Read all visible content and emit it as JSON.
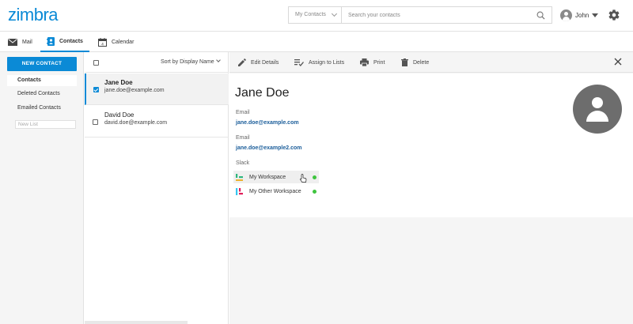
{
  "app": {
    "logo": "zimbra"
  },
  "search": {
    "scope": "My Contacts",
    "placeholder": "Search your contacts"
  },
  "user": {
    "name": "John"
  },
  "nav": {
    "tabs": [
      {
        "label": "Mail"
      },
      {
        "label": "Contacts"
      },
      {
        "label": "Calendar"
      }
    ]
  },
  "sidebar": {
    "new_contact_label": "NEW CONTACT",
    "items": [
      {
        "label": "Contacts"
      },
      {
        "label": "Deleted Contacts"
      },
      {
        "label": "Emailed Contacts"
      }
    ],
    "new_list_placeholder": "New List"
  },
  "list": {
    "sort_label": "Sort by Display Name",
    "contacts": [
      {
        "name": "Jane Doe",
        "email": "jane.doe@example.com",
        "checked": true
      },
      {
        "name": "David Doe",
        "email": "david.doe@example.com",
        "checked": false
      }
    ]
  },
  "toolbar": {
    "edit": "Edit Details",
    "assign": "Assign to Lists",
    "print": "Print",
    "delete": "Delete"
  },
  "detail": {
    "name": "Jane Doe",
    "fields": [
      {
        "label": "Email",
        "value": "jane.doe@example.com"
      },
      {
        "label": "Email",
        "value": "jane.doe@example2.com"
      }
    ],
    "slack_label": "Slack",
    "workspaces": [
      {
        "name": "My Workspace",
        "status": "online"
      },
      {
        "name": "My Other Workspace",
        "status": "online"
      }
    ],
    "status_color": "#3fc43f"
  },
  "colors": {
    "accent": "#0b8ad6",
    "link": "#1a5d9a"
  }
}
